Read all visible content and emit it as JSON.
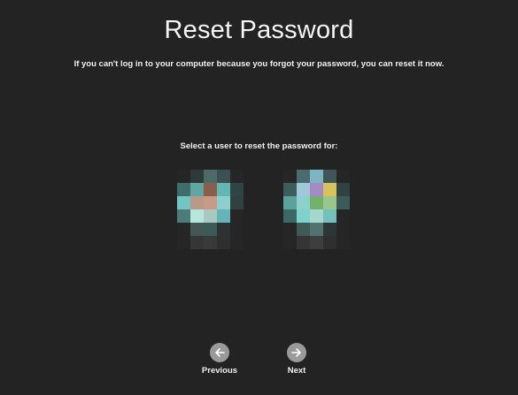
{
  "header": {
    "title": "Reset Password",
    "subtitle": "If you can't log in to your computer because you forgot your password, you can reset it now."
  },
  "user_picker": {
    "prompt": "Select a user to reset the password for:",
    "users": [
      {
        "avatar_pixels": [
          [
            "#262626",
            "#2f3a38",
            "#4a6c69",
            "#3b5050",
            "#262626"
          ],
          [
            "#3f6d69",
            "#5fa7a2",
            "#8a5f4a",
            "#62b7b3",
            "#2f4543"
          ],
          [
            "#72c6c2",
            "#b89a86",
            "#c89b86",
            "#8bd0cc",
            "#2f4240"
          ],
          [
            "#4c7b78",
            "#b7e6df",
            "#a8c9c0",
            "#66b4ba",
            "#262626"
          ],
          [
            "#262626",
            "#455754",
            "#3c5b58",
            "#2c3232",
            "#262626"
          ],
          [
            "#262626",
            "#363636",
            "#3a3a3a",
            "#2f2f2f",
            "#262626"
          ]
        ]
      },
      {
        "avatar_pixels": [
          [
            "#262626",
            "#4a6b70",
            "#7eb5c5",
            "#3f5558",
            "#262626"
          ],
          [
            "#3b5e5c",
            "#9fc8db",
            "#a58ac6",
            "#d7c25d",
            "#2f4240"
          ],
          [
            "#5aa29d",
            "#8ed0cb",
            "#74b16b",
            "#97c78b",
            "#3a5b58"
          ],
          [
            "#3b6864",
            "#7ed2cd",
            "#a7d6cf",
            "#75c0bc",
            "#262626"
          ],
          [
            "#262626",
            "#3f5a57",
            "#50736f",
            "#2c3636",
            "#262626"
          ],
          [
            "#262626",
            "#353535",
            "#3e3e3e",
            "#2f2f2f",
            "#262626"
          ]
        ]
      }
    ]
  },
  "navigation": {
    "previous_label": "Previous",
    "previous_icon": "arrow-left-icon",
    "next_label": "Next",
    "next_icon": "arrow-right-icon"
  },
  "colors": {
    "background": "#232323",
    "nav_circle": "#9a9a9a",
    "text": "#f0f0f0"
  }
}
